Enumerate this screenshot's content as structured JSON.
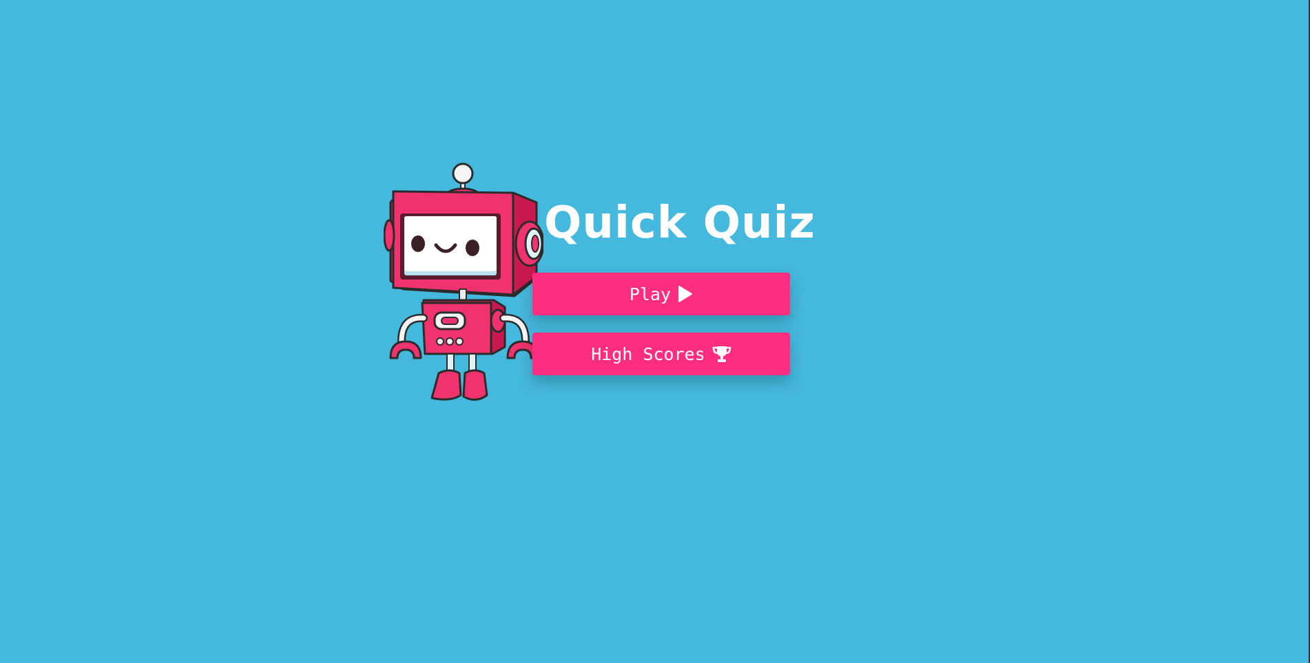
{
  "app": {
    "title": "Quick Quiz"
  },
  "menu": {
    "play_label": "Play",
    "play_icon": "play-icon",
    "high_scores_label": "High Scores",
    "high_scores_icon": "trophy-icon"
  },
  "mascot": {
    "icon": "robot-illustration"
  },
  "colors": {
    "background": "#45b8dd",
    "button": "#ff2d7f",
    "text": "#ffffff",
    "robot_body": "#f0326e"
  }
}
